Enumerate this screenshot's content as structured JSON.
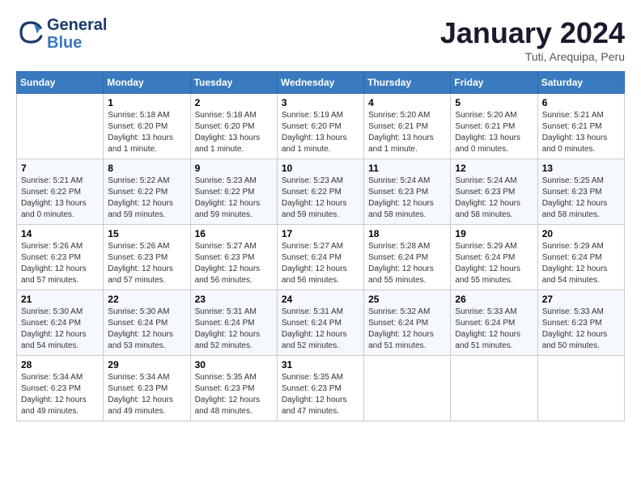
{
  "header": {
    "logo_line1": "General",
    "logo_line2": "Blue",
    "month_title": "January 2024",
    "subtitle": "Tuti, Arequipa, Peru"
  },
  "weekdays": [
    "Sunday",
    "Monday",
    "Tuesday",
    "Wednesday",
    "Thursday",
    "Friday",
    "Saturday"
  ],
  "weeks": [
    [
      {
        "day": "",
        "info": ""
      },
      {
        "day": "1",
        "info": "Sunrise: 5:18 AM\nSunset: 6:20 PM\nDaylight: 13 hours\nand 1 minute."
      },
      {
        "day": "2",
        "info": "Sunrise: 5:18 AM\nSunset: 6:20 PM\nDaylight: 13 hours\nand 1 minute."
      },
      {
        "day": "3",
        "info": "Sunrise: 5:19 AM\nSunset: 6:20 PM\nDaylight: 13 hours\nand 1 minute."
      },
      {
        "day": "4",
        "info": "Sunrise: 5:20 AM\nSunset: 6:21 PM\nDaylight: 13 hours\nand 1 minute."
      },
      {
        "day": "5",
        "info": "Sunrise: 5:20 AM\nSunset: 6:21 PM\nDaylight: 13 hours\nand 0 minutes."
      },
      {
        "day": "6",
        "info": "Sunrise: 5:21 AM\nSunset: 6:21 PM\nDaylight: 13 hours\nand 0 minutes."
      }
    ],
    [
      {
        "day": "7",
        "info": "Sunrise: 5:21 AM\nSunset: 6:22 PM\nDaylight: 13 hours\nand 0 minutes."
      },
      {
        "day": "8",
        "info": "Sunrise: 5:22 AM\nSunset: 6:22 PM\nDaylight: 12 hours\nand 59 minutes."
      },
      {
        "day": "9",
        "info": "Sunrise: 5:23 AM\nSunset: 6:22 PM\nDaylight: 12 hours\nand 59 minutes."
      },
      {
        "day": "10",
        "info": "Sunrise: 5:23 AM\nSunset: 6:22 PM\nDaylight: 12 hours\nand 59 minutes."
      },
      {
        "day": "11",
        "info": "Sunrise: 5:24 AM\nSunset: 6:23 PM\nDaylight: 12 hours\nand 58 minutes."
      },
      {
        "day": "12",
        "info": "Sunrise: 5:24 AM\nSunset: 6:23 PM\nDaylight: 12 hours\nand 58 minutes."
      },
      {
        "day": "13",
        "info": "Sunrise: 5:25 AM\nSunset: 6:23 PM\nDaylight: 12 hours\nand 58 minutes."
      }
    ],
    [
      {
        "day": "14",
        "info": "Sunrise: 5:26 AM\nSunset: 6:23 PM\nDaylight: 12 hours\nand 57 minutes."
      },
      {
        "day": "15",
        "info": "Sunrise: 5:26 AM\nSunset: 6:23 PM\nDaylight: 12 hours\nand 57 minutes."
      },
      {
        "day": "16",
        "info": "Sunrise: 5:27 AM\nSunset: 6:23 PM\nDaylight: 12 hours\nand 56 minutes."
      },
      {
        "day": "17",
        "info": "Sunrise: 5:27 AM\nSunset: 6:24 PM\nDaylight: 12 hours\nand 56 minutes."
      },
      {
        "day": "18",
        "info": "Sunrise: 5:28 AM\nSunset: 6:24 PM\nDaylight: 12 hours\nand 55 minutes."
      },
      {
        "day": "19",
        "info": "Sunrise: 5:29 AM\nSunset: 6:24 PM\nDaylight: 12 hours\nand 55 minutes."
      },
      {
        "day": "20",
        "info": "Sunrise: 5:29 AM\nSunset: 6:24 PM\nDaylight: 12 hours\nand 54 minutes."
      }
    ],
    [
      {
        "day": "21",
        "info": "Sunrise: 5:30 AM\nSunset: 6:24 PM\nDaylight: 12 hours\nand 54 minutes."
      },
      {
        "day": "22",
        "info": "Sunrise: 5:30 AM\nSunset: 6:24 PM\nDaylight: 12 hours\nand 53 minutes."
      },
      {
        "day": "23",
        "info": "Sunrise: 5:31 AM\nSunset: 6:24 PM\nDaylight: 12 hours\nand 52 minutes."
      },
      {
        "day": "24",
        "info": "Sunrise: 5:31 AM\nSunset: 6:24 PM\nDaylight: 12 hours\nand 52 minutes."
      },
      {
        "day": "25",
        "info": "Sunrise: 5:32 AM\nSunset: 6:24 PM\nDaylight: 12 hours\nand 51 minutes."
      },
      {
        "day": "26",
        "info": "Sunrise: 5:33 AM\nSunset: 6:24 PM\nDaylight: 12 hours\nand 51 minutes."
      },
      {
        "day": "27",
        "info": "Sunrise: 5:33 AM\nSunset: 6:23 PM\nDaylight: 12 hours\nand 50 minutes."
      }
    ],
    [
      {
        "day": "28",
        "info": "Sunrise: 5:34 AM\nSunset: 6:23 PM\nDaylight: 12 hours\nand 49 minutes."
      },
      {
        "day": "29",
        "info": "Sunrise: 5:34 AM\nSunset: 6:23 PM\nDaylight: 12 hours\nand 49 minutes."
      },
      {
        "day": "30",
        "info": "Sunrise: 5:35 AM\nSunset: 6:23 PM\nDaylight: 12 hours\nand 48 minutes."
      },
      {
        "day": "31",
        "info": "Sunrise: 5:35 AM\nSunset: 6:23 PM\nDaylight: 12 hours\nand 47 minutes."
      },
      {
        "day": "",
        "info": ""
      },
      {
        "day": "",
        "info": ""
      },
      {
        "day": "",
        "info": ""
      }
    ]
  ]
}
